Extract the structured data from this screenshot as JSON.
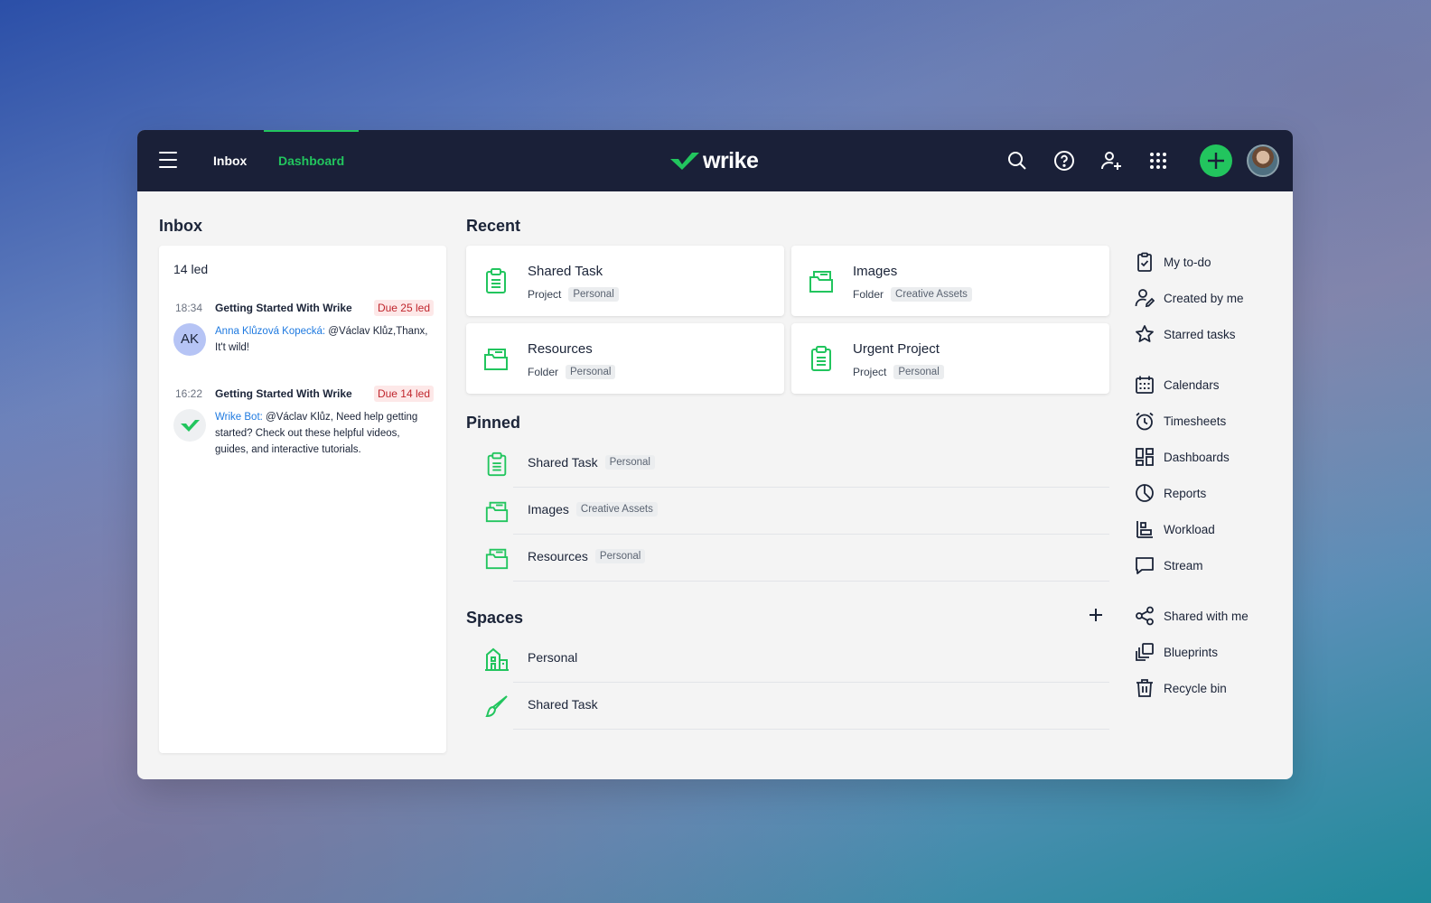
{
  "nav": {
    "inbox_label": "Inbox",
    "dashboard_label": "Dashboard",
    "logo_text": "wrike",
    "accent": "#22c55e",
    "bar_color": "#1a2038"
  },
  "inbox": {
    "title": "Inbox",
    "date": "14 led",
    "messages": [
      {
        "time": "18:34",
        "title": "Getting Started With Wrike",
        "due": "Due 25 led",
        "avatar": "AK",
        "author": "Anna Klůzová Kopecká:",
        "text": " @Václav Klůz,Thanx, It't wild!"
      },
      {
        "time": "16:22",
        "title": "Getting Started With Wrike",
        "due": "Due 14 led",
        "avatar": "wrike-check-icon",
        "author": "Wrike Bot:",
        "text": " @Václav Klůz, Need help getting started? Check out these helpful videos, guides, and interactive tutorials."
      }
    ]
  },
  "recent": {
    "title": "Recent",
    "cards": [
      {
        "name": "Shared Task",
        "type": "Project",
        "tag": "Personal",
        "icon": "clipboard-icon"
      },
      {
        "name": "Images",
        "type": "Folder",
        "tag": "Creative Assets",
        "icon": "folder-icon"
      },
      {
        "name": "Resources",
        "type": "Folder",
        "tag": "Personal",
        "icon": "folder-icon"
      },
      {
        "name": "Urgent Project",
        "type": "Project",
        "tag": "Personal",
        "icon": "clipboard-icon"
      }
    ]
  },
  "pinned": {
    "title": "Pinned",
    "items": [
      {
        "name": "Shared Task",
        "tag": "Personal",
        "icon": "clipboard-icon"
      },
      {
        "name": "Images",
        "tag": "Creative Assets",
        "icon": "folder-icon"
      },
      {
        "name": "Resources",
        "tag": "Personal",
        "icon": "folder-icon"
      }
    ]
  },
  "spaces": {
    "title": "Spaces",
    "items": [
      {
        "name": "Personal",
        "icon": "building-icon"
      },
      {
        "name": "Shared Task",
        "icon": "brush-icon"
      }
    ]
  },
  "sidebar": {
    "items": [
      {
        "label": "My to-do",
        "icon": "checklist-icon"
      },
      {
        "label": "Created by me",
        "icon": "user-edit-icon"
      },
      {
        "label": "Starred tasks",
        "icon": "star-icon"
      },
      {
        "label": "Calendars",
        "icon": "calendar-icon"
      },
      {
        "label": "Timesheets",
        "icon": "stopwatch-icon"
      },
      {
        "label": "Dashboards",
        "icon": "dashboard-icon"
      },
      {
        "label": "Reports",
        "icon": "pie-chart-icon"
      },
      {
        "label": "Workload",
        "icon": "workload-icon"
      },
      {
        "label": "Stream",
        "icon": "chat-icon"
      },
      {
        "label": "Shared with me",
        "icon": "share-icon"
      },
      {
        "label": "Blueprints",
        "icon": "blueprint-icon"
      },
      {
        "label": "Recycle bin",
        "icon": "trash-icon"
      }
    ]
  }
}
